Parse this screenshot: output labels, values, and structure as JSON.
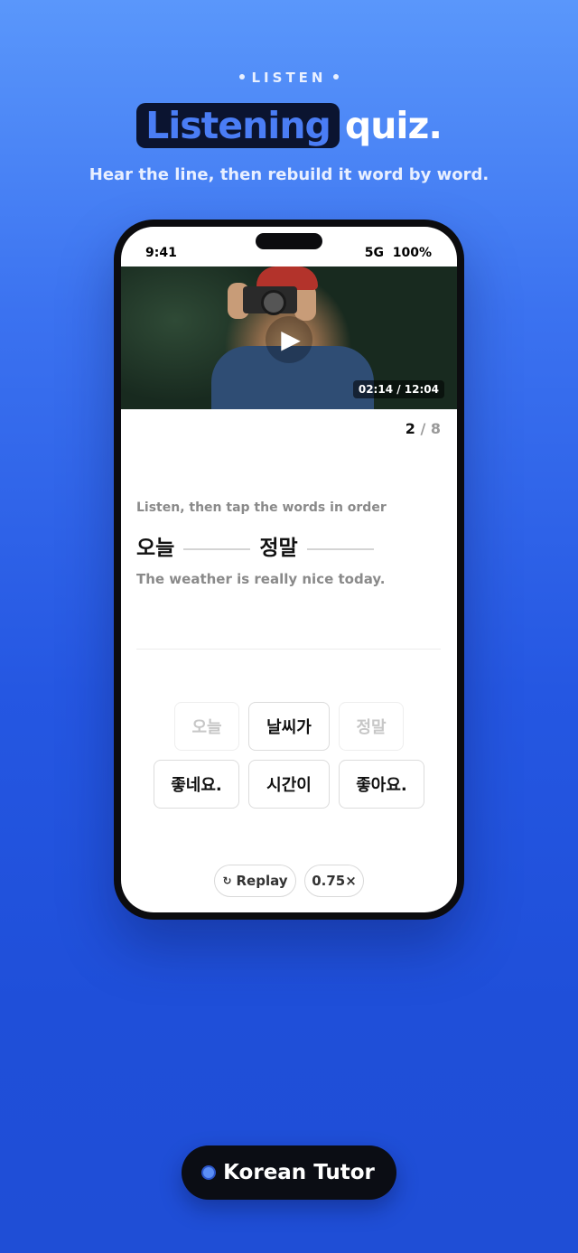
{
  "header": {
    "eyebrow": "LISTEN",
    "title_highlight": "Listening",
    "title_rest": "quiz.",
    "subtitle": "Hear the line, then rebuild it word by word."
  },
  "status_bar": {
    "time": "9:41",
    "network": "5G",
    "battery": "100%"
  },
  "video": {
    "timecode": "02:14 / 12:04",
    "play_icon": "play-icon"
  },
  "progress": {
    "current": "2",
    "total": "/ 8"
  },
  "exercise": {
    "prompt": "Listen, then tap the words in order",
    "answer_words": [
      "오늘",
      "정말"
    ],
    "translation": "The weather is really nice today."
  },
  "word_bank": [
    {
      "text": "오늘",
      "used": true
    },
    {
      "text": "날씨가",
      "used": false
    },
    {
      "text": "정말",
      "used": true
    },
    {
      "text": "좋네요.",
      "used": false
    },
    {
      "text": "시간이",
      "used": false
    },
    {
      "text": "좋아요.",
      "used": false
    }
  ],
  "controls": {
    "replay_icon": "↻",
    "replay_label": "Replay",
    "speed_label": "0.75×"
  },
  "brand": {
    "name": "Korean Tutor"
  },
  "colors": {
    "highlight_bg": "#0b1430",
    "highlight_text": "#4a7df5",
    "accent": "#5b8ef5"
  }
}
